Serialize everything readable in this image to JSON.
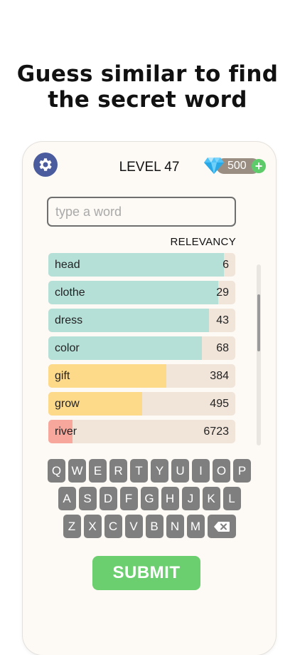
{
  "headline": {
    "line1": "Guess similar to find",
    "line2": "the secret word"
  },
  "header": {
    "level_label": "LEVEL 47",
    "gems": "500"
  },
  "input": {
    "placeholder": "type a word",
    "value": ""
  },
  "list_header": "RELEVANCY",
  "guesses": [
    {
      "word": "head",
      "rank": "6",
      "fill_fraction": 0.94,
      "color": "#b5e0d8"
    },
    {
      "word": "clothe",
      "rank": "29",
      "fill_fraction": 0.91,
      "color": "#b5e0d8"
    },
    {
      "word": "dress",
      "rank": "43",
      "fill_fraction": 0.86,
      "color": "#b5e0d8"
    },
    {
      "word": "color",
      "rank": "68",
      "fill_fraction": 0.82,
      "color": "#b5e0d8"
    },
    {
      "word": "gift",
      "rank": "384",
      "fill_fraction": 0.63,
      "color": "#fdd98a"
    },
    {
      "word": "grow",
      "rank": "495",
      "fill_fraction": 0.5,
      "color": "#fdd98a"
    },
    {
      "word": "river",
      "rank": "6723",
      "fill_fraction": 0.13,
      "color": "#f8a79c"
    }
  ],
  "keyboard": {
    "row1": [
      "Q",
      "W",
      "E",
      "R",
      "T",
      "Y",
      "U",
      "I",
      "O",
      "P"
    ],
    "row2": [
      "A",
      "S",
      "D",
      "F",
      "G",
      "H",
      "J",
      "K",
      "L"
    ],
    "row3": [
      "Z",
      "X",
      "C",
      "V",
      "B",
      "N",
      "M"
    ]
  },
  "submit_label": "SUBMIT",
  "colors": {
    "accent": "#6bcf70",
    "gear_bg": "#4a5b9e",
    "key_bg": "#7f7f7f"
  }
}
